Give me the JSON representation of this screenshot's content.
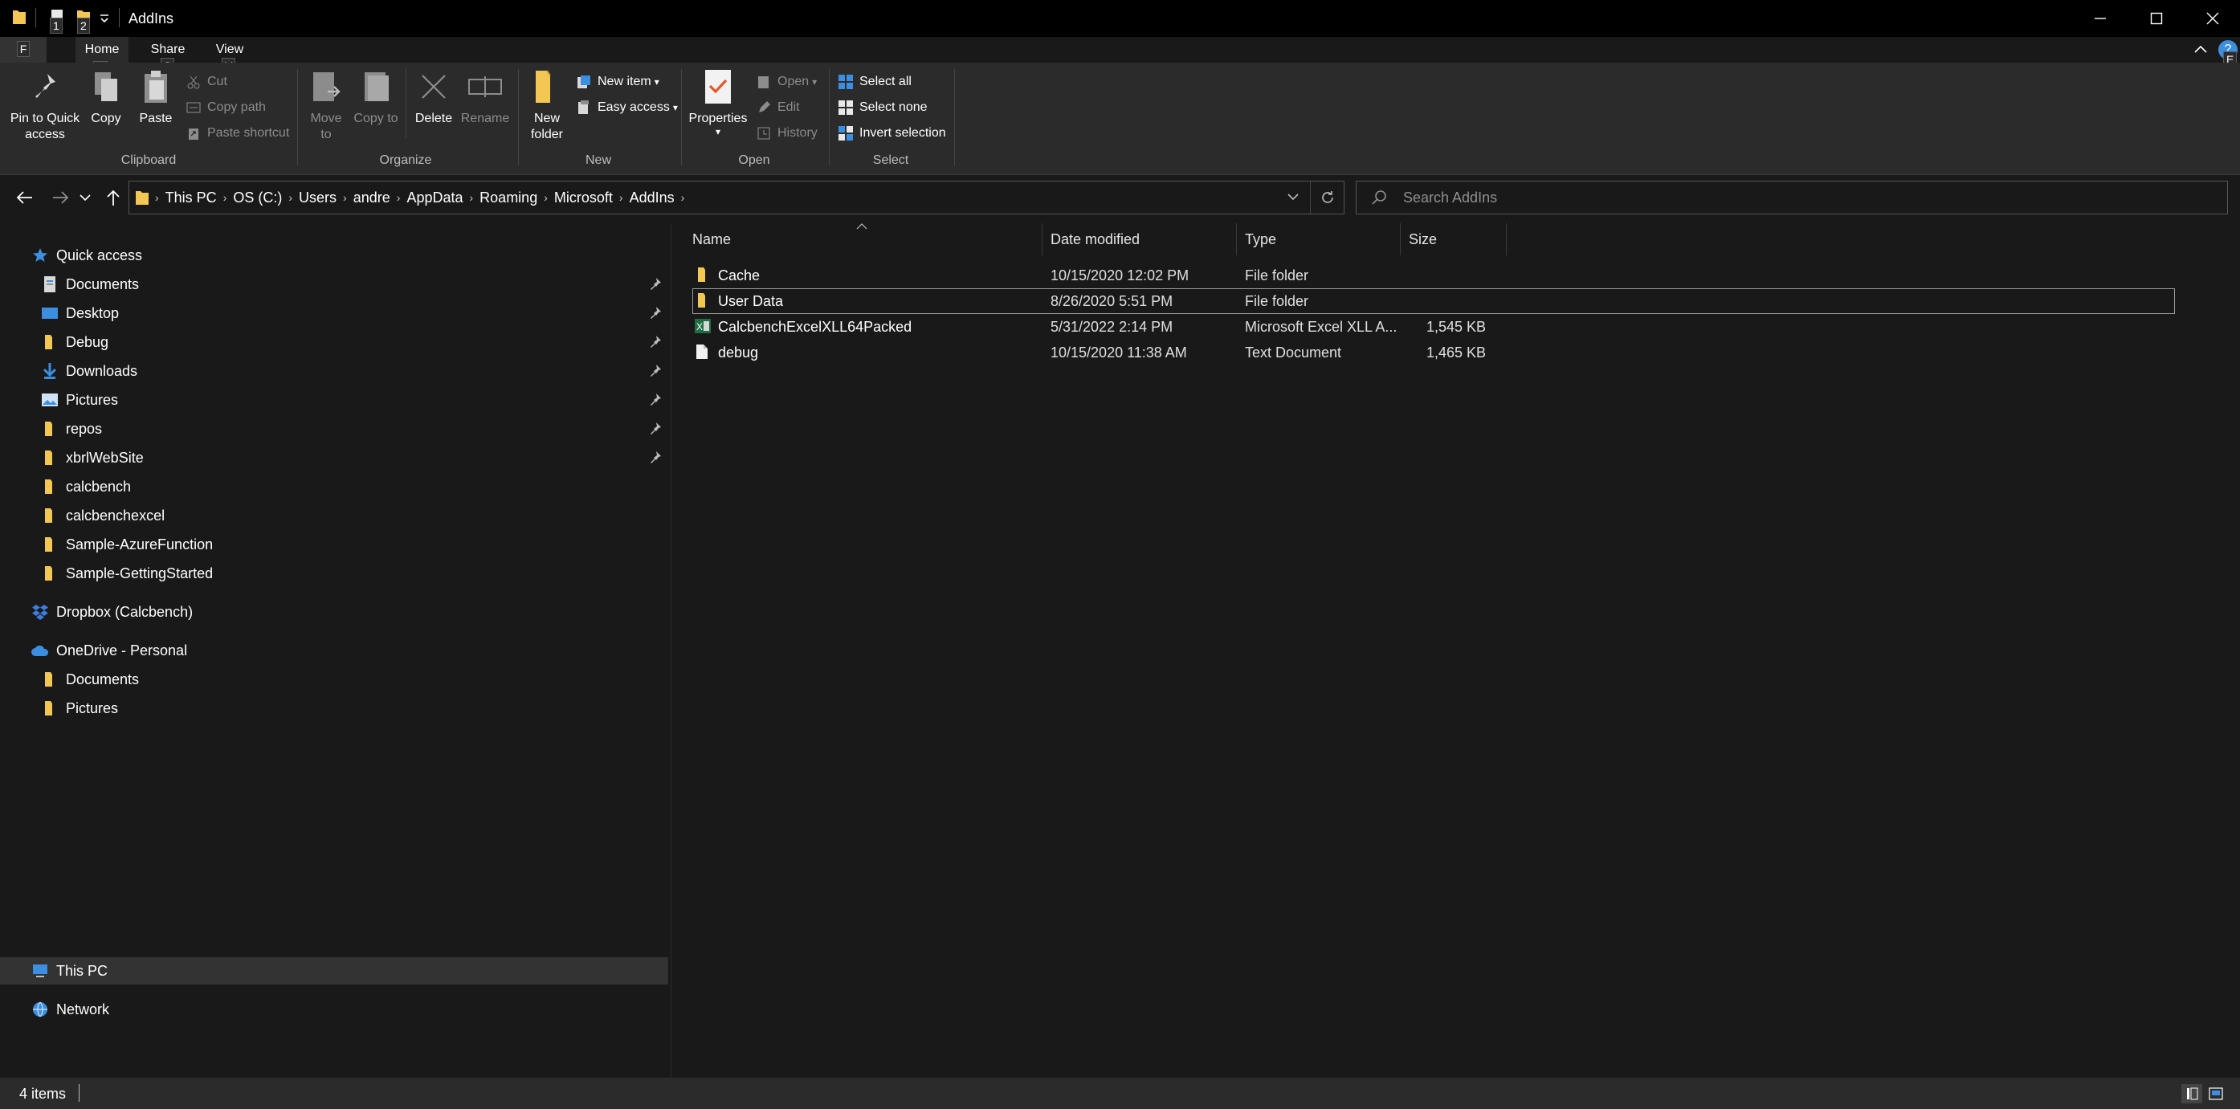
{
  "window": {
    "title": "AddIns",
    "quick_access_keytips": [
      "1",
      "2"
    ],
    "controls": {
      "minimize": "—",
      "maximize": "☐",
      "close": "✕"
    }
  },
  "ribbon": {
    "tabs": [
      {
        "label": "F",
        "keytip": ""
      },
      {
        "label": "Home",
        "keytip": "H"
      },
      {
        "label": "Share",
        "keytip": "S"
      },
      {
        "label": "View",
        "keytip": "V"
      }
    ],
    "help_keytip": "E",
    "clipboard": {
      "label": "Clipboard",
      "pin": "Pin to Quick access",
      "copy": "Copy",
      "paste": "Paste",
      "cut": "Cut",
      "copy_path": "Copy path",
      "paste_shortcut": "Paste shortcut"
    },
    "organize": {
      "label": "Organize",
      "move_to": "Move to",
      "copy_to": "Copy to",
      "delete": "Delete",
      "rename": "Rename"
    },
    "new": {
      "label": "New",
      "new_folder": "New folder",
      "new_item": "New item",
      "easy_access": "Easy access"
    },
    "open": {
      "label": "Open",
      "properties": "Properties",
      "open": "Open",
      "edit": "Edit",
      "history": "History"
    },
    "select": {
      "label": "Select",
      "select_all": "Select all",
      "select_none": "Select none",
      "invert_selection": "Invert selection"
    }
  },
  "address": {
    "crumbs": [
      "This PC",
      "OS (C:)",
      "Users",
      "andre",
      "AppData",
      "Roaming",
      "Microsoft",
      "AddIns"
    ],
    "search_placeholder": "Search AddIns"
  },
  "navpane": {
    "quick_access": "Quick access",
    "quick_items": [
      {
        "label": "Documents",
        "icon": "documents-icon",
        "pinned": true
      },
      {
        "label": "Desktop",
        "icon": "desktop-icon",
        "pinned": true
      },
      {
        "label": "Debug",
        "icon": "folder-icon",
        "pinned": true
      },
      {
        "label": "Downloads",
        "icon": "downloads-icon",
        "pinned": true
      },
      {
        "label": "Pictures",
        "icon": "pictures-icon",
        "pinned": true
      },
      {
        "label": "repos",
        "icon": "folder-icon",
        "pinned": true
      },
      {
        "label": "xbrlWebSite",
        "icon": "folder-icon",
        "pinned": true
      },
      {
        "label": "calcbench",
        "icon": "folder-icon",
        "pinned": false
      },
      {
        "label": "calcbenchexcel",
        "icon": "folder-icon",
        "pinned": false
      },
      {
        "label": "Sample-AzureFunction",
        "icon": "folder-icon",
        "pinned": false
      },
      {
        "label": "Sample-GettingStarted",
        "icon": "folder-icon",
        "pinned": false
      }
    ],
    "dropbox": "Dropbox (Calcbench)",
    "onedrive": "OneDrive - Personal",
    "onedrive_items": [
      "Documents",
      "Pictures"
    ],
    "this_pc": "This PC",
    "network": "Network"
  },
  "filelist": {
    "columns": {
      "name": "Name",
      "date": "Date modified",
      "type": "Type",
      "size": "Size"
    },
    "rows": [
      {
        "name": "Cache",
        "date": "10/15/2020 12:02 PM",
        "type": "File folder",
        "size": "",
        "icon": "folder-icon"
      },
      {
        "name": "User Data",
        "date": "8/26/2020 5:51 PM",
        "type": "File folder",
        "size": "",
        "icon": "folder-icon"
      },
      {
        "name": "CalcbenchExcelXLL64Packed",
        "date": "5/31/2022 2:14 PM",
        "type": "Microsoft Excel XLL A...",
        "size": "1,545 KB",
        "icon": "excel-xll-icon"
      },
      {
        "name": "debug",
        "date": "10/15/2020 11:38 AM",
        "type": "Text Document",
        "size": "1,465 KB",
        "icon": "text-document-icon"
      }
    ]
  },
  "status": {
    "items_count": "4 items"
  },
  "colors": {
    "background": "#191919",
    "ribbon": "#2b2b2b",
    "titlebar": "#000000",
    "folder": "#f3c754",
    "accent_blue": "#3c8fe0"
  }
}
